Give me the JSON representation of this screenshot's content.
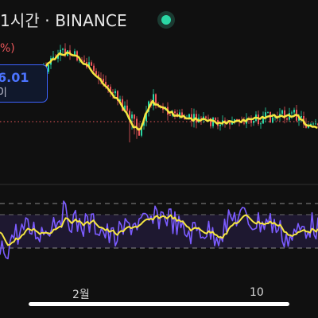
{
  "header": {
    "title": "1시간 · BINANCE",
    "change_text": "%)",
    "status_icon": "green-dot-icon"
  },
  "price_tag": {
    "value": "6.01",
    "subtext": "0|"
  },
  "axis": {
    "x_labels": [
      "2월",
      "10"
    ]
  },
  "colors": {
    "background": "#101010",
    "candle_up": "#2bd7a5",
    "candle_down": "#e9565a",
    "moving_average": "#f5e642",
    "rsi_line": "#7b5cff",
    "rsi_signal": "#f5e642",
    "price_tag_border": "#3d63ff",
    "status_dot": "#2bd7a5"
  }
}
